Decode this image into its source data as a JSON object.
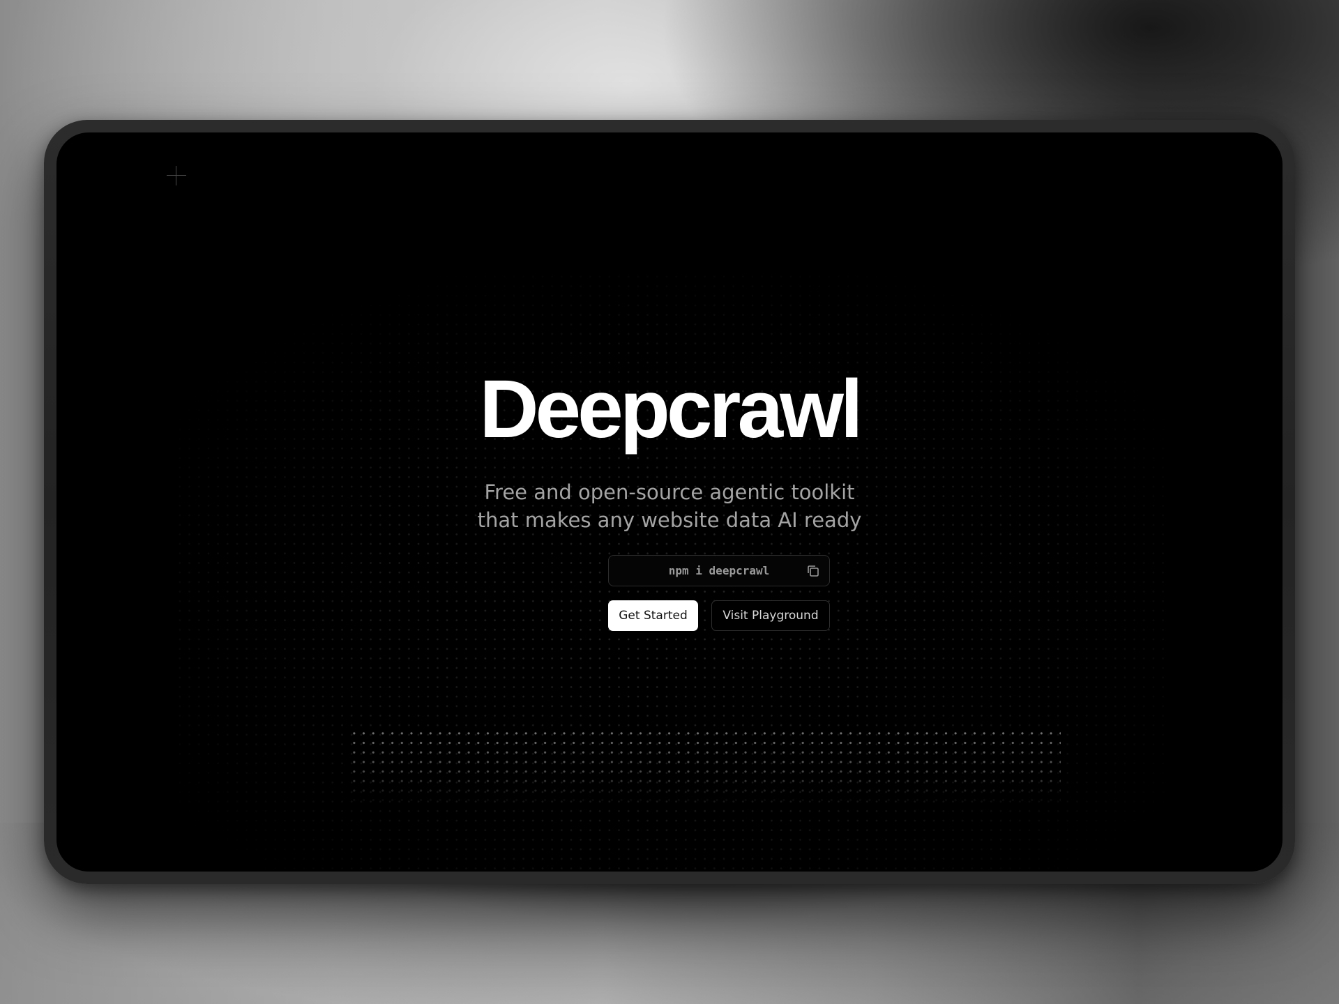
{
  "hero": {
    "title": "Deepcrawl",
    "subtitle_line1": "Free and open-source agentic toolkit",
    "subtitle_line2": "that makes any website data AI ready"
  },
  "install": {
    "command": "npm i deepcrawl",
    "copy_icon": "copy-icon"
  },
  "actions": {
    "primary_label": "Get Started",
    "secondary_label": "Visit Playground"
  },
  "decor": {
    "corner_mark": "plus-icon"
  },
  "colors": {
    "background": "#000000",
    "title": "#ffffff",
    "subtitle": "#a4a4a4",
    "primary_button": "#ffffff"
  }
}
